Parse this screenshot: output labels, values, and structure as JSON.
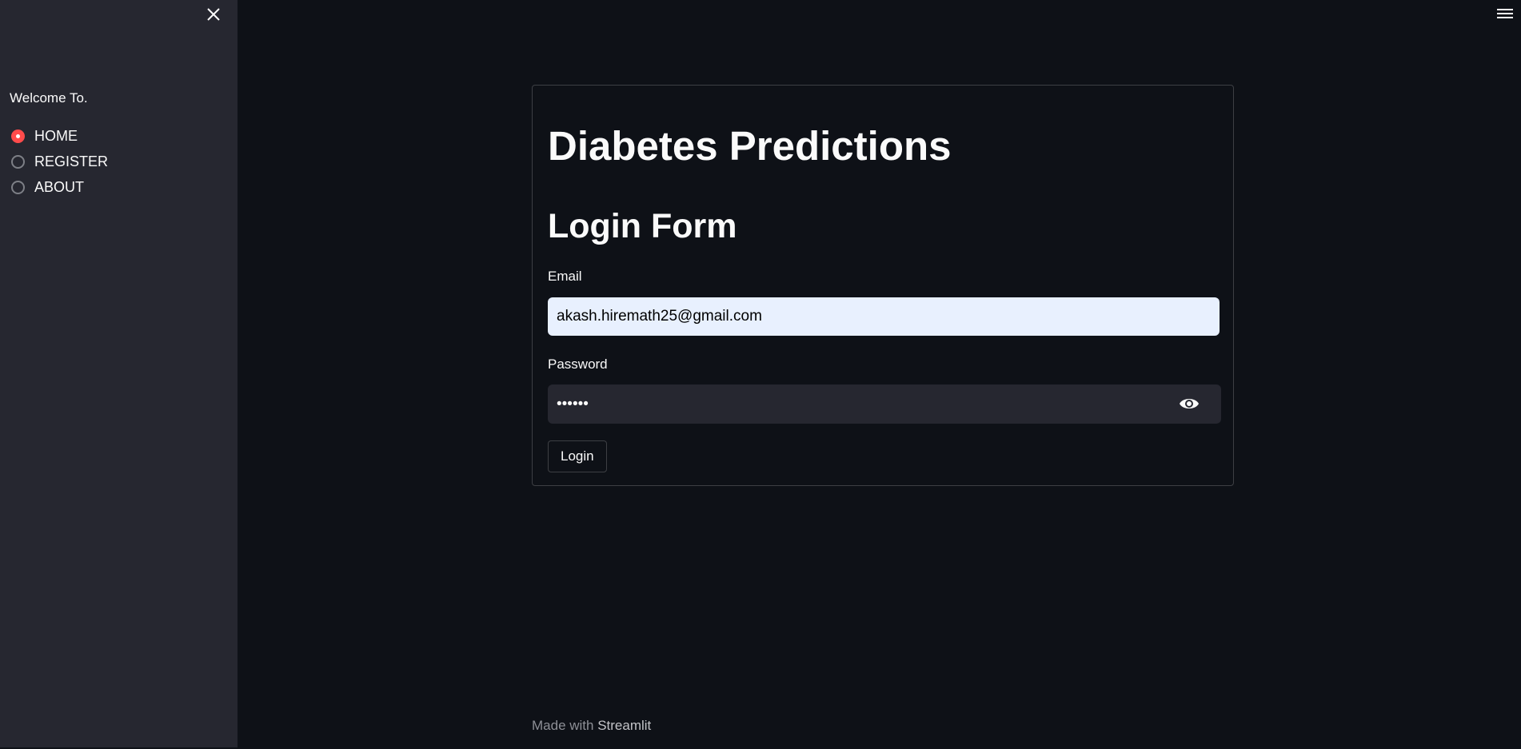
{
  "sidebar": {
    "close_icon": "close-icon",
    "caption": "Welcome To.",
    "options": [
      {
        "label": "HOME",
        "selected": true
      },
      {
        "label": "REGISTER",
        "selected": false
      },
      {
        "label": "ABOUT",
        "selected": false
      }
    ]
  },
  "header": {
    "menu_icon": "hamburger-menu-icon"
  },
  "main": {
    "title": "Diabetes Predictions",
    "subtitle": "Login Form",
    "email": {
      "label": "Email",
      "value": "akash.hiremath25@gmail.com"
    },
    "password": {
      "label": "Password",
      "value": "••••••",
      "toggle_icon": "eye-icon"
    },
    "login_button": "Login"
  },
  "footer": {
    "prefix": "Made with ",
    "link": "Streamlit"
  },
  "colors": {
    "accent": "#ff4b4b",
    "background": "#0e1117",
    "sidebar": "#262730"
  }
}
